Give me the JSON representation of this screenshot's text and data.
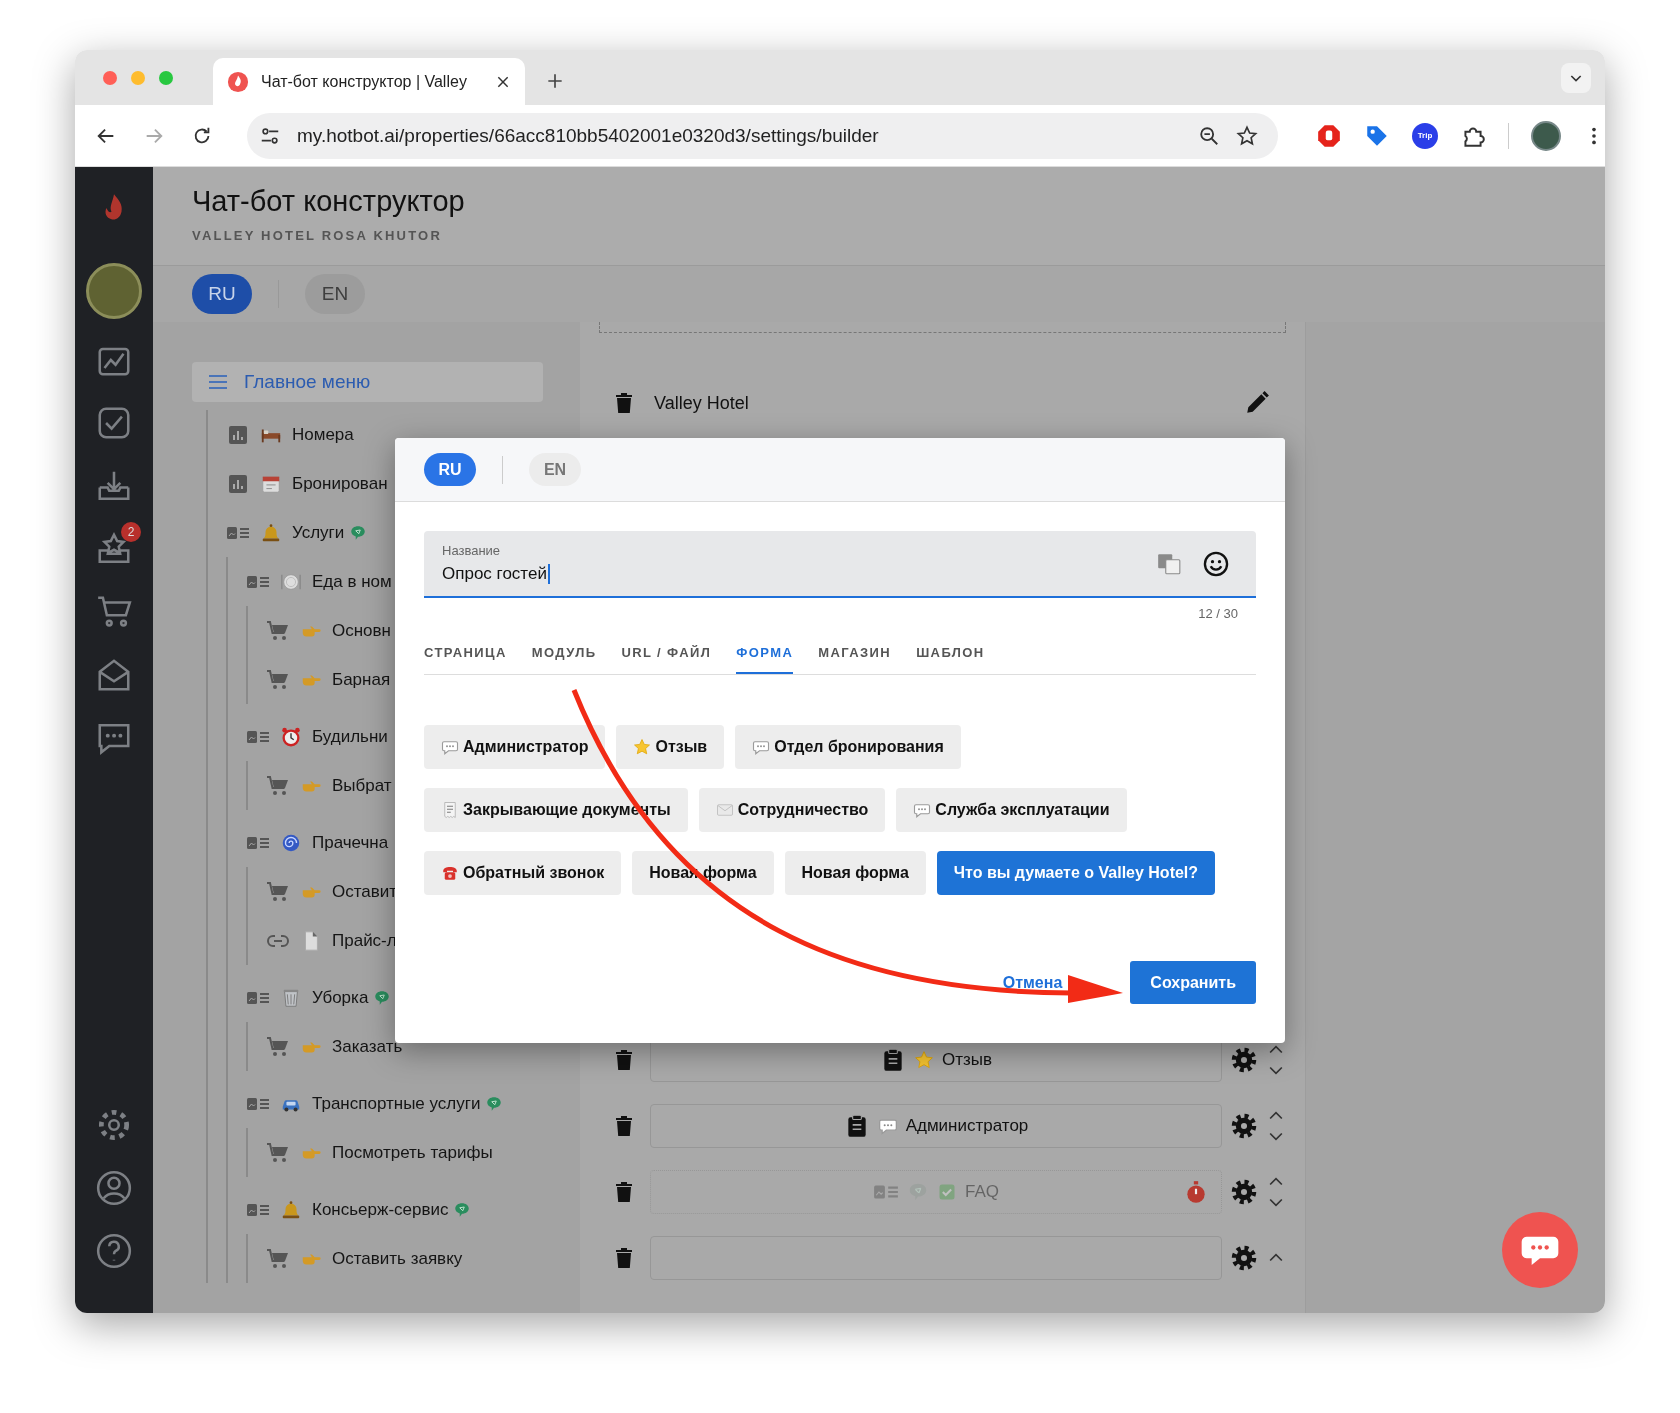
{
  "browser": {
    "tab_title": "Чат-бот конструктор | Valley",
    "url": "my.hotbot.ai/properties/66acc810bb5402001e0320d3/settings/builder",
    "extension_label": "Trip"
  },
  "sidebar": {
    "notification_count": "2"
  },
  "header": {
    "title": "Чат-бот конструктор",
    "subtitle": "VALLEY HOTEL ROSA KHUTOR"
  },
  "languages": [
    {
      "label": "RU",
      "selected": true
    },
    {
      "label": "EN",
      "selected": false
    }
  ],
  "tree": {
    "title": "Главное меню",
    "items": [
      {
        "label": "Номера",
        "kind": "chart",
        "emoji": {
          "kind": "bed"
        },
        "linked": false
      },
      {
        "label": "Бронирован",
        "kind": "chart",
        "emoji": {
          "kind": "calendar"
        },
        "linked": false
      },
      {
        "label": "Услуги",
        "kind": "list",
        "emoji": {
          "kind": "bell"
        },
        "linked": true,
        "children": [
          {
            "label": "Еда в ном",
            "kind": "list",
            "emoji": {
              "kind": "plate"
            },
            "linked": false,
            "children": [
              {
                "label": "Основн",
                "kind": "cart",
                "emoji": {
                  "kind": "hand"
                },
                "linked": false
              },
              {
                "label": "Барная",
                "kind": "cart",
                "emoji": {
                  "kind": "hand"
                },
                "linked": false
              }
            ]
          },
          {
            "label": "Будильни",
            "kind": "list",
            "emoji": {
              "kind": "alarm"
            },
            "linked": false,
            "children": [
              {
                "label": "Выбрат",
                "kind": "cart",
                "emoji": {
                  "kind": "hand"
                },
                "linked": false
              }
            ]
          },
          {
            "label": "Прачечна",
            "kind": "list",
            "emoji": {
              "kind": "cyclone"
            },
            "linked": false,
            "children": [
              {
                "label": "Оставит",
                "kind": "cart",
                "emoji": {
                  "kind": "hand"
                },
                "linked": false
              },
              {
                "label": "Прайс-л",
                "kind": "link",
                "emoji": {
                  "kind": "page"
                },
                "linked": false
              }
            ]
          },
          {
            "label": "Уборка",
            "kind": "list",
            "emoji": {
              "kind": "waste"
            },
            "linked": true,
            "children": [
              {
                "label": "Заказать",
                "kind": "cart",
                "emoji": {
                  "kind": "hand"
                },
                "linked": false
              }
            ]
          },
          {
            "label": "Транспортные услуги",
            "kind": "list",
            "emoji": {
              "kind": "car"
            },
            "linked": true,
            "children": [
              {
                "label": "Посмотреть тарифы",
                "kind": "cart",
                "emoji": {
                  "kind": "hand"
                },
                "linked": false
              }
            ]
          },
          {
            "label": "Консьерж-сервис",
            "kind": "list",
            "emoji": {
              "kind": "bell"
            },
            "linked": true,
            "children": [
              {
                "label": "Оставить заявку",
                "kind": "cart",
                "emoji": {
                  "kind": "hand"
                },
                "linked": false
              }
            ]
          }
        ]
      }
    ]
  },
  "canvas": {
    "title": "Valley Hotel",
    "blocks": [
      {
        "kind": "form",
        "emoji": {
          "kind": "star"
        },
        "label": "Отзыв",
        "disabled": false,
        "timer": false,
        "move_down": true
      },
      {
        "kind": "form",
        "emoji": {
          "kind": "chat"
        },
        "label": "Администратор",
        "disabled": false,
        "timer": false,
        "move_down": true
      },
      {
        "kind": "menu",
        "emoji": {
          "kind": "check"
        },
        "label": "FAQ",
        "disabled": true,
        "timer": true,
        "move_down": true
      },
      {
        "kind": "empty",
        "disabled": false,
        "timer": false,
        "move_down": false
      }
    ]
  },
  "modal": {
    "languages": [
      {
        "label": "RU",
        "selected": true
      },
      {
        "label": "EN",
        "selected": false
      }
    ],
    "field": {
      "label": "Название",
      "value": "Опрос гостей",
      "counter": "12 / 30"
    },
    "tabs": [
      {
        "label": "СТРАНИЦА",
        "selected": false
      },
      {
        "label": "МОДУЛЬ",
        "selected": false
      },
      {
        "label": "URL / ФАЙЛ",
        "selected": false
      },
      {
        "label": "ФОРМА",
        "selected": true
      },
      {
        "label": "МАГАЗИН",
        "selected": false
      },
      {
        "label": "ШАБЛОН",
        "selected": false
      }
    ],
    "form_rows": [
      {
        "items": [
          {
            "label": "Администратор",
            "emoji": {
              "kind": "chat"
            },
            "selected": false
          },
          {
            "label": "Отзыв",
            "emoji": {
              "kind": "star"
            },
            "selected": false
          },
          {
            "label": "Отдел бронирования",
            "emoji": {
              "kind": "chat"
            },
            "selected": false
          }
        ]
      },
      {
        "items": [
          {
            "label": "Закрывающие документы",
            "emoji": {
              "kind": "receipt"
            },
            "selected": false
          },
          {
            "label": "Сотрудничество",
            "emoji": {
              "kind": "envelope"
            },
            "selected": false
          },
          {
            "label": "Служба эксплуатации",
            "emoji": {
              "kind": "chat"
            },
            "selected": false
          }
        ]
      },
      {
        "items": [
          {
            "label": "Обратный звонок",
            "emoji": {
              "kind": "phone"
            },
            "selected": false
          },
          {
            "label": "Новая форма",
            "selected": false
          },
          {
            "label": "Новая форма",
            "selected": false
          },
          {
            "label": "Что вы думаете о Valley Hotel?",
            "selected": true
          }
        ]
      }
    ],
    "cancel": "Отмена",
    "save": "Сохранить"
  }
}
